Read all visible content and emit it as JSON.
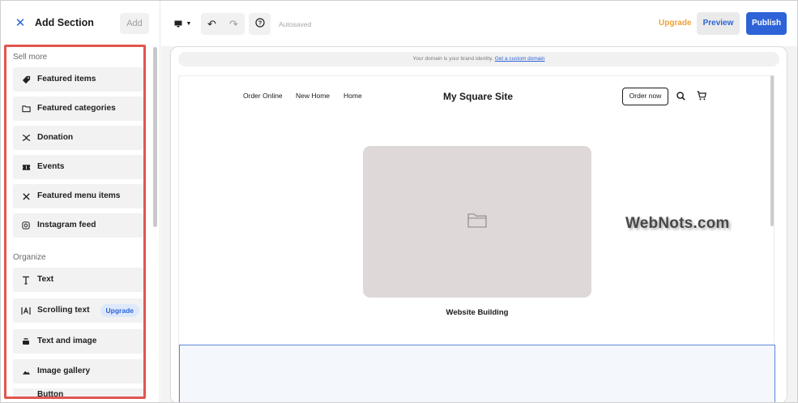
{
  "panel": {
    "title": "Add Section",
    "add_label": "Add",
    "groups": [
      {
        "label": "Sell more",
        "items": [
          {
            "label": "Featured items",
            "icon": "tag-icon"
          },
          {
            "label": "Featured categories",
            "icon": "folder-icon"
          },
          {
            "label": "Donation",
            "icon": "ribbon-icon"
          },
          {
            "label": "Events",
            "icon": "ticket-icon"
          },
          {
            "label": "Featured menu items",
            "icon": "utensils-icon"
          },
          {
            "label": "Instagram feed",
            "icon": "instagram-icon"
          }
        ]
      },
      {
        "label": "Organize",
        "items": [
          {
            "label": "Text",
            "icon": "text-icon"
          },
          {
            "label": "Scrolling text",
            "icon": "scrolling-text-icon",
            "badge": "Upgrade"
          },
          {
            "label": "Text and image",
            "icon": "text-image-icon"
          },
          {
            "label": "Image gallery",
            "icon": "gallery-icon"
          },
          {
            "label": "Button",
            "icon": "button-icon"
          }
        ]
      }
    ]
  },
  "toolbar": {
    "autosaved": "Autosaved",
    "upgrade": "Upgrade",
    "preview": "Preview",
    "publish": "Publish"
  },
  "preview": {
    "domain_text": "Your domain is your brand identity.",
    "domain_link": "Get a custom domain",
    "nav": [
      "Order Online",
      "New Home",
      "Home"
    ],
    "site_title": "My Square Site",
    "order_button": "Order now",
    "hero_caption": "Website Building"
  },
  "watermark": "WebNots.com",
  "colors": {
    "accent": "#2e63d8",
    "upgrade": "#f0a038",
    "highlight_border": "#e0564e",
    "image_placeholder": "#ded9d8"
  }
}
